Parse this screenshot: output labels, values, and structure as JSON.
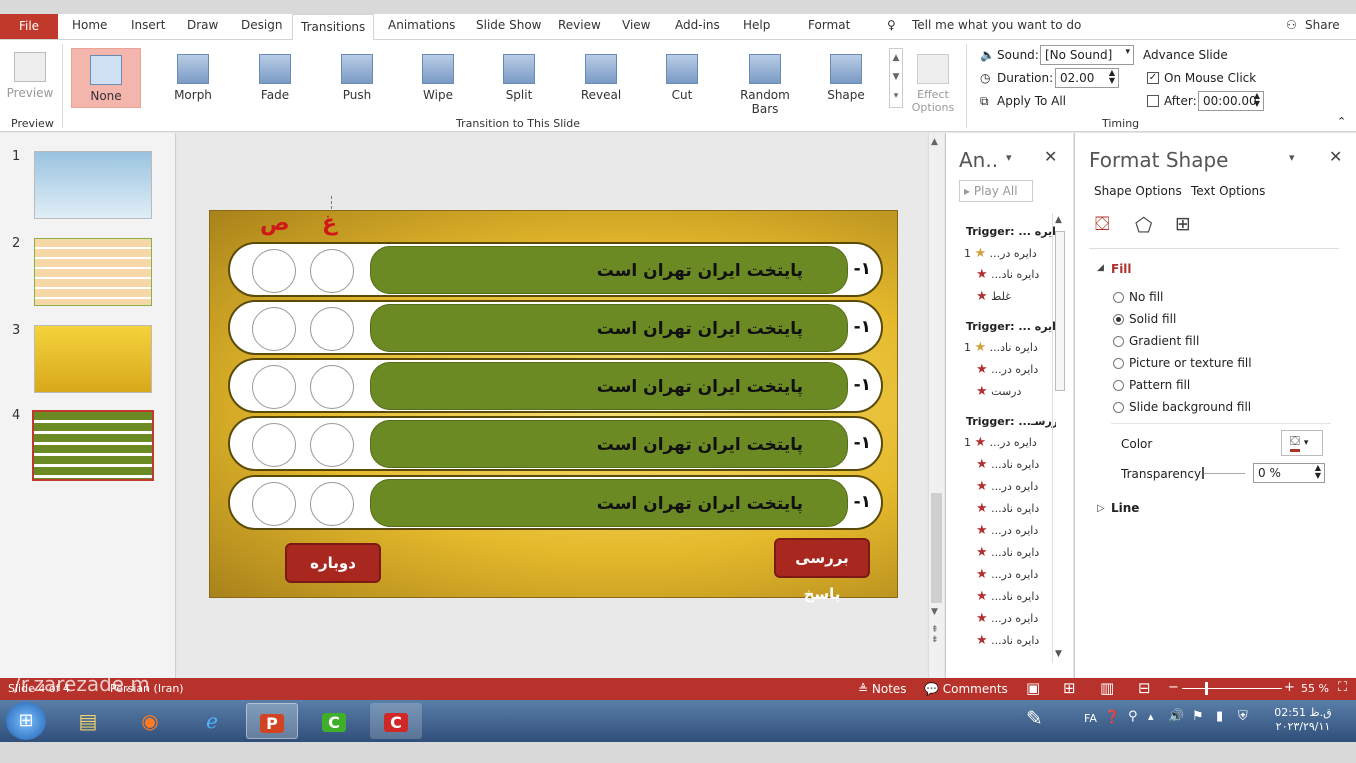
{
  "tabs": [
    "File",
    "Home",
    "Insert",
    "Draw",
    "Design",
    "Transitions",
    "Animations",
    "Slide Show",
    "Review",
    "View",
    "Add-ins",
    "Help",
    "Format"
  ],
  "tell_me": "Tell me what you want to do",
  "share": "Share",
  "ribbon": {
    "preview": "Preview",
    "preview_group": "Preview",
    "transitions": [
      "None",
      "Morph",
      "Fade",
      "Push",
      "Wipe",
      "Split",
      "Reveal",
      "Cut",
      "Random Bars",
      "Shape"
    ],
    "effect_options": "Effect Options",
    "group_label": "Transition to This Slide",
    "sound_label": "Sound:",
    "sound_value": "[No Sound]",
    "duration_label": "Duration:",
    "duration_value": "02.00",
    "apply_all": "Apply To All",
    "advance_slide": "Advance Slide",
    "on_mouse_click": "On Mouse Click",
    "after_label": "After:",
    "after_value": "00:00.00",
    "timing_group": "Timing"
  },
  "slides": [
    "1",
    "2",
    "3",
    "4"
  ],
  "slide": {
    "headers": [
      "غ",
      "ص"
    ],
    "rows": [
      {
        "num": "-۱",
        "text": "پایتخت ایران تهران است"
      },
      {
        "num": "-۱",
        "text": "پایتخت ایران تهران است"
      },
      {
        "num": "-۱",
        "text": "پایتخت ایران تهران است"
      },
      {
        "num": "-۱",
        "text": "پایتخت ایران تهران است"
      },
      {
        "num": "-۱",
        "text": "پایتخت ایران تهران است"
      }
    ],
    "btn_retry": "دوباره",
    "btn_check": "بررسی پاسخ"
  },
  "anim": {
    "title": "An..",
    "play_all": "Play All",
    "items": [
      {
        "type": "trigger",
        "text": "Trigger: ... دایره"
      },
      {
        "type": "item",
        "num": "1",
        "text": "...دایره در"
      },
      {
        "type": "item",
        "num": "",
        "text": "...دایره ناد"
      },
      {
        "type": "item",
        "num": "",
        "text": "غلط"
      },
      {
        "type": "trigger",
        "text": "Trigger: ... دایره"
      },
      {
        "type": "item",
        "num": "1",
        "text": "...دایره ناد"
      },
      {
        "type": "item",
        "num": "",
        "text": "...دایره در"
      },
      {
        "type": "item",
        "num": "",
        "text": "درست"
      },
      {
        "type": "trigger",
        "text": "Trigger: ...بررسـ"
      },
      {
        "type": "item",
        "num": "1",
        "text": "...دایره در"
      },
      {
        "type": "item",
        "num": "",
        "text": "...دایره ناد"
      },
      {
        "type": "item",
        "num": "",
        "text": "...دایره در"
      },
      {
        "type": "item",
        "num": "",
        "text": "...دایره ناد"
      },
      {
        "type": "item",
        "num": "",
        "text": "...دایره در"
      },
      {
        "type": "item",
        "num": "",
        "text": "...دایره ناد"
      },
      {
        "type": "item",
        "num": "",
        "text": "...دایره در"
      },
      {
        "type": "item",
        "num": "",
        "text": "...دایره ناد"
      },
      {
        "type": "item",
        "num": "",
        "text": "...دایره در"
      },
      {
        "type": "item",
        "num": "",
        "text": "...دایره ناد"
      }
    ]
  },
  "format": {
    "title": "Format Shape",
    "tab_shape": "Shape Options",
    "tab_text": "Text Options",
    "fill_section": "Fill",
    "fill_options": [
      "No fill",
      "Solid fill",
      "Gradient fill",
      "Picture or texture fill",
      "Pattern fill",
      "Slide background fill"
    ],
    "selected_fill": 1,
    "color_label": "Color",
    "transparency_label": "Transparency",
    "transparency_value": "0 %",
    "line_section": "Line"
  },
  "status": {
    "slide_info": "Slide 4 of 4",
    "language": "Persian (Iran)",
    "watermark": "/r.zarezade.m",
    "notes": "Notes",
    "comments": "Comments",
    "zoom": "55 %"
  },
  "taskbar": {
    "lang": "FA",
    "time": "02:51 ق.ظ",
    "date": "۲۰۲۳/۲۹/۱۱"
  }
}
